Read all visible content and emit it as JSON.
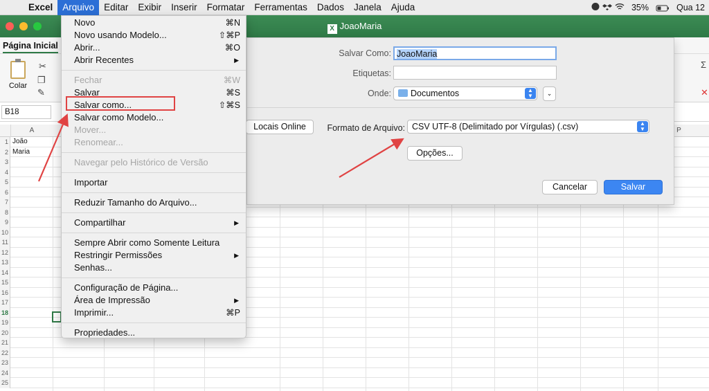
{
  "menubar": {
    "app": "Excel",
    "items": [
      "Arquivo",
      "Editar",
      "Exibir",
      "Inserir",
      "Formatar",
      "Ferramentas",
      "Dados",
      "Janela",
      "Ajuda"
    ],
    "battery": "35%",
    "clock": "Qua 12"
  },
  "window": {
    "title": "JoaoMaria"
  },
  "ribbon": {
    "active_tab": "Página Inicial",
    "paste_label": "Colar"
  },
  "formula": {
    "name_box": "B18"
  },
  "sheet": {
    "columns": [
      "A",
      "P"
    ],
    "row_numbers": [
      "1",
      "2",
      "3",
      "4",
      "5",
      "6",
      "7",
      "8",
      "9",
      "10",
      "11",
      "12",
      "13",
      "14",
      "15",
      "16",
      "17",
      "18",
      "19",
      "20",
      "21",
      "22",
      "23",
      "24",
      "25"
    ],
    "cells": {
      "A1": "João",
      "A2": "Maria"
    },
    "selected_row": "18"
  },
  "file_menu": {
    "items": [
      {
        "label": "Novo",
        "shortcut": "⌘N"
      },
      {
        "label": "Novo usando Modelo...",
        "shortcut": "⇧⌘P"
      },
      {
        "label": "Abrir...",
        "shortcut": "⌘O"
      },
      {
        "label": "Abrir Recentes",
        "submenu": "▶"
      },
      {
        "label": "Fechar",
        "shortcut": "⌘W",
        "disabled": true
      },
      {
        "label": "Salvar",
        "shortcut": "⌘S"
      },
      {
        "label": "Salvar como...",
        "shortcut": "⇧⌘S",
        "highlighted": true
      },
      {
        "label": "Salvar como Modelo..."
      },
      {
        "label": "Mover...",
        "disabled": true
      },
      {
        "label": "Renomear...",
        "disabled": true
      },
      {
        "label": "Navegar pelo Histórico de Versão",
        "disabled": true
      },
      {
        "label": "Importar"
      },
      {
        "label": "Reduzir Tamanho do Arquivo..."
      },
      {
        "label": "Compartilhar",
        "submenu": "▶"
      },
      {
        "label": "Sempre Abrir como Somente Leitura"
      },
      {
        "label": "Restringir Permissões",
        "submenu": "▶"
      },
      {
        "label": "Senhas..."
      },
      {
        "label": "Configuração de Página..."
      },
      {
        "label": "Área de Impressão",
        "submenu": "▶"
      },
      {
        "label": "Imprimir...",
        "shortcut": "⌘P"
      },
      {
        "label": "Propriedades..."
      }
    ]
  },
  "save_dialog": {
    "save_as_label": "Salvar Como:",
    "save_as_value": "JoaoMaria",
    "tags_label": "Etiquetas:",
    "where_label": "Onde:",
    "where_value": "Documentos",
    "online_button": "Locais Online",
    "format_label": "Formato de Arquivo:",
    "format_value": "CSV UTF-8 (Delimitado por Vírgulas) (.csv)",
    "options_button": "Opções...",
    "cancel_button": "Cancelar",
    "save_button": "Salvar"
  },
  "colors": {
    "excel_green": "#2f7a47",
    "highlight_red": "#e04343",
    "accent_blue": "#3c86f2"
  }
}
